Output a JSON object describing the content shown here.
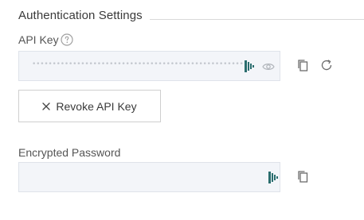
{
  "section": {
    "title": "Authentication Settings"
  },
  "api_key": {
    "label": "API Key",
    "help_icon": "question-circle-icon",
    "masked_value": "••••••••••••••••••••••••••••••••••••••••••••••••••••••••••••",
    "icons": [
      "password-manager-icon",
      "eye-icon",
      "copy-icon",
      "refresh-icon"
    ]
  },
  "revoke_button": {
    "label": "Revoke API Key",
    "icon": "close-icon"
  },
  "encrypted_password": {
    "label": "Encrypted Password",
    "value": "",
    "icons": [
      "password-manager-icon",
      "copy-icon"
    ]
  },
  "colors": {
    "field_background": "#f3f5f9",
    "field_border": "#dfe3ea",
    "brand_icon": "#2a6d6e",
    "icon_gray": "#6b6b6b"
  }
}
